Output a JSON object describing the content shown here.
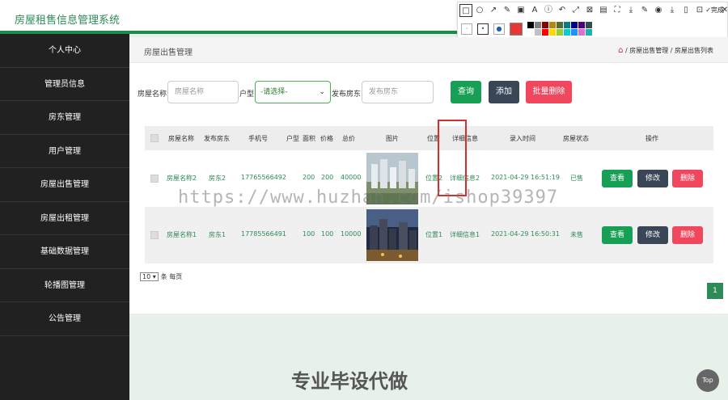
{
  "header": {
    "app_title": "房屋租售信息管理系统",
    "avatar_text": ""
  },
  "toolbar": {
    "icons": [
      "□",
      "○",
      "↗",
      "✎",
      "▣",
      "A",
      "ⓘ",
      "↶",
      "⤢",
      "⊠",
      "▤",
      "⛶",
      "⤓",
      "✎",
      "◉",
      "⤓",
      "▯",
      "⊡",
      "✕",
      "✓"
    ],
    "done_label": "✓完成",
    "brush_sizes": [
      "·",
      "•",
      "●"
    ],
    "current_color": "#e53935",
    "palette": [
      "#000000",
      "#808080",
      "#8b0000",
      "#b8860b",
      "#556b2f",
      "#008080",
      "#00008b",
      "#4b0082",
      "#2f4f4f",
      "#ffffff",
      "#c0c0c0",
      "#ff0000",
      "#ffd700",
      "#9acd32",
      "#00ced1",
      "#1e90ff",
      "#da70d6",
      "#20b2aa"
    ]
  },
  "sidebar": {
    "items": [
      {
        "label": "个人中心"
      },
      {
        "label": "管理员信息"
      },
      {
        "label": "房东管理"
      },
      {
        "label": "用户管理"
      },
      {
        "label": "房屋出售管理"
      },
      {
        "label": "房屋出租管理"
      },
      {
        "label": "基础数据管理"
      },
      {
        "label": "轮播图管理"
      },
      {
        "label": "公告管理"
      }
    ]
  },
  "page": {
    "title": "房屋出售管理",
    "breadcrumb": [
      "房屋出售管理",
      "房屋出售列表"
    ],
    "home_icon": "⌂"
  },
  "search": {
    "name_label": "房屋名称",
    "name_placeholder": "房屋名称",
    "type_label": "户型",
    "type_selected": "-请选择-",
    "landlord_label": "发布房东",
    "landlord_placeholder": "发布房东",
    "query_label": "查询",
    "add_label": "添加",
    "batch_delete_label": "批量删除"
  },
  "table": {
    "headers": [
      "房屋名称",
      "发布房东",
      "手机号",
      "户型",
      "面积",
      "价格",
      "总价",
      "图片",
      "位置",
      "详细信息",
      "录入时间",
      "房屋状态",
      "操作"
    ],
    "rows": [
      {
        "name": "房屋名称2",
        "landlord": "房东2",
        "phone": "17765566492",
        "type": "",
        "area": "200",
        "price": "200",
        "total": "40000",
        "location": "位置2",
        "detail": "详细信息2",
        "time": "2021-04-29 16:51:19",
        "status": "已售",
        "view": "查看",
        "edit": "修改",
        "delete": "删除"
      },
      {
        "name": "房屋名称1",
        "landlord": "房东1",
        "phone": "17785566491",
        "type": "",
        "area": "100",
        "price": "100",
        "total": "10000",
        "location": "位置1",
        "detail": "详细信息1",
        "time": "2021-04-29 16:50:31",
        "status": "未售",
        "view": "查看",
        "edit": "修改",
        "delete": "删除"
      }
    ]
  },
  "pager": {
    "page_size": "10",
    "per_page_label": "条 每页",
    "current_page": "1"
  },
  "watermark": "https://www.huzhan.com/ishop39397",
  "footer": {
    "banner": "专业毕设代做",
    "top_label": "Top"
  },
  "colors": {
    "accent": "#2e8b57",
    "sidebar": "#212121",
    "delete": "#f0475f",
    "edit": "#3a4556"
  }
}
